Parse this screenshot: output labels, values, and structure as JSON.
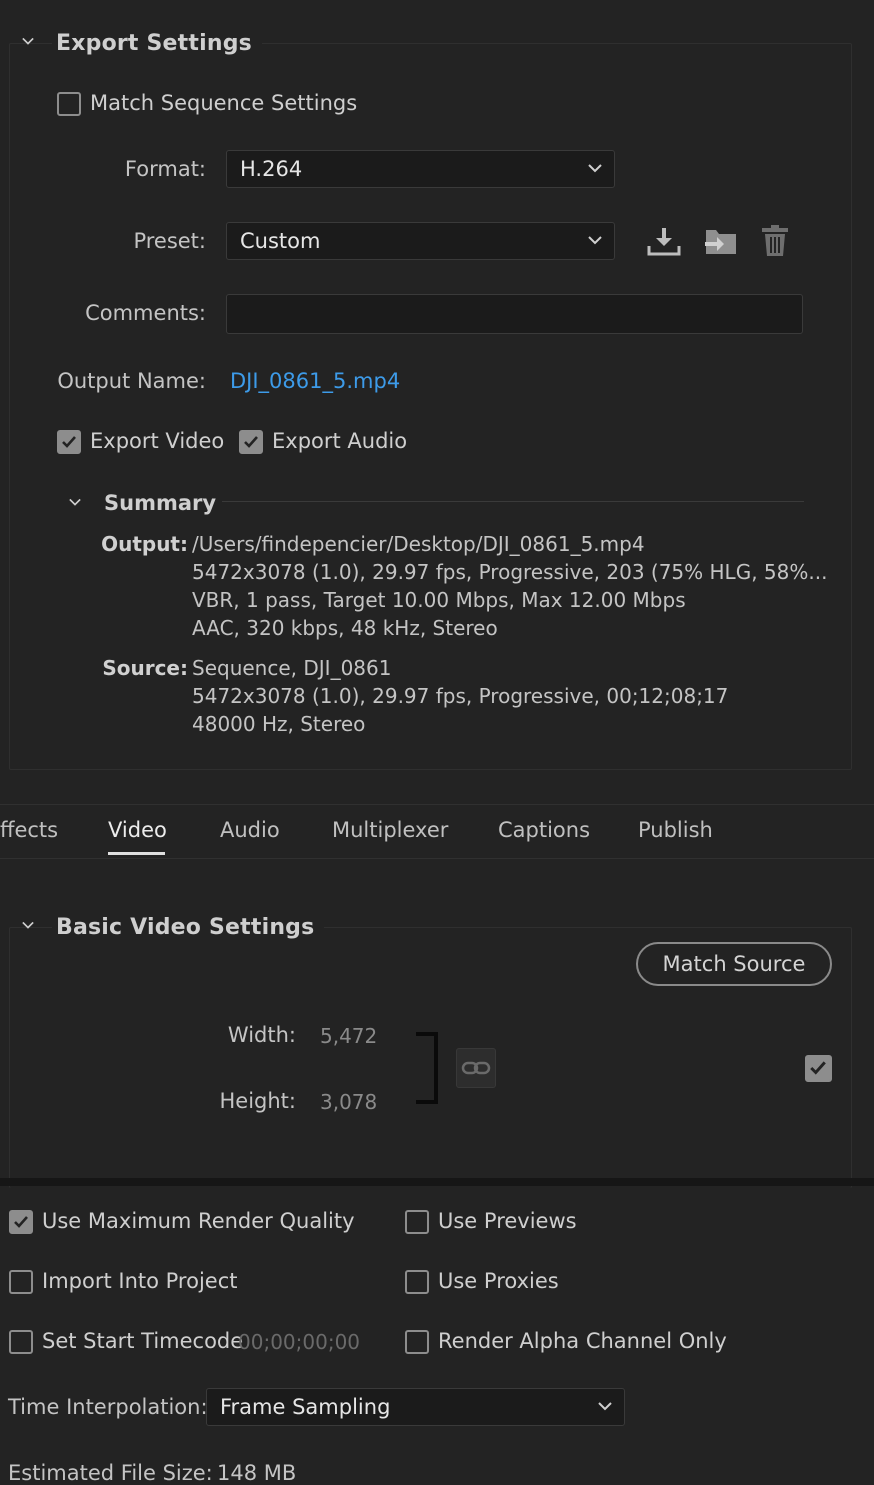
{
  "export_settings": {
    "title": "Export Settings",
    "match_sequence_label": "Match Sequence Settings",
    "match_sequence_checked": false,
    "format_label": "Format:",
    "format_value": "H.264",
    "preset_label": "Preset:",
    "preset_value": "Custom",
    "comments_label": "Comments:",
    "comments_value": "",
    "output_name_label": "Output Name:",
    "output_name_value": "DJI_0861_5.mp4",
    "export_video_label": "Export Video",
    "export_video_checked": true,
    "export_audio_label": "Export Audio",
    "export_audio_checked": true,
    "icons": [
      "save-preset-icon",
      "import-preset-icon",
      "delete-preset-icon"
    ]
  },
  "summary": {
    "title": "Summary",
    "output_key": "Output:",
    "output_lines": [
      "/Users/findepencier/Desktop/DJI_0861_5.mp4",
      "5472x3078 (1.0), 29.97 fps, Progressive, 203 (75% HLG, 58%...",
      "VBR, 1 pass, Target 10.00 Mbps, Max 12.00 Mbps",
      "AAC, 320 kbps, 48 kHz, Stereo"
    ],
    "source_key": "Source:",
    "source_lines": [
      "Sequence, DJI_0861",
      "5472x3078 (1.0), 29.97 fps, Progressive, 00;12;08;17",
      "48000 Hz, Stereo"
    ]
  },
  "tabs": [
    "ffects",
    "Video",
    "Audio",
    "Multiplexer",
    "Captions",
    "Publish"
  ],
  "active_tab": "Video",
  "basic_video": {
    "title": "Basic Video Settings",
    "match_source_label": "Match Source",
    "width_label": "Width:",
    "width_value": "5,472",
    "height_label": "Height:",
    "height_value": "3,078",
    "dimension_checkbox_checked": true
  },
  "bottom": {
    "use_max_render_quality_label": "Use Maximum Render Quality",
    "use_max_render_quality_checked": true,
    "use_previews_label": "Use Previews",
    "use_previews_checked": false,
    "import_into_project_label": "Import Into Project",
    "import_into_project_checked": false,
    "use_proxies_label": "Use Proxies",
    "use_proxies_checked": false,
    "set_start_timecode_label": "Set Start Timecode",
    "set_start_timecode_value": "00;00;00;00",
    "set_start_timecode_checked": false,
    "render_alpha_label": "Render Alpha Channel Only",
    "render_alpha_checked": false,
    "time_interpolation_label": "Time Interpolation:",
    "time_interpolation_value": "Frame Sampling",
    "estimated_size_label": "Estimated File Size:",
    "estimated_size_value": "148 MB"
  },
  "colors": {
    "background": "#232323",
    "link": "#3d9be9",
    "checkbox": "#8d8d8d",
    "field": "#1b1b1b"
  }
}
